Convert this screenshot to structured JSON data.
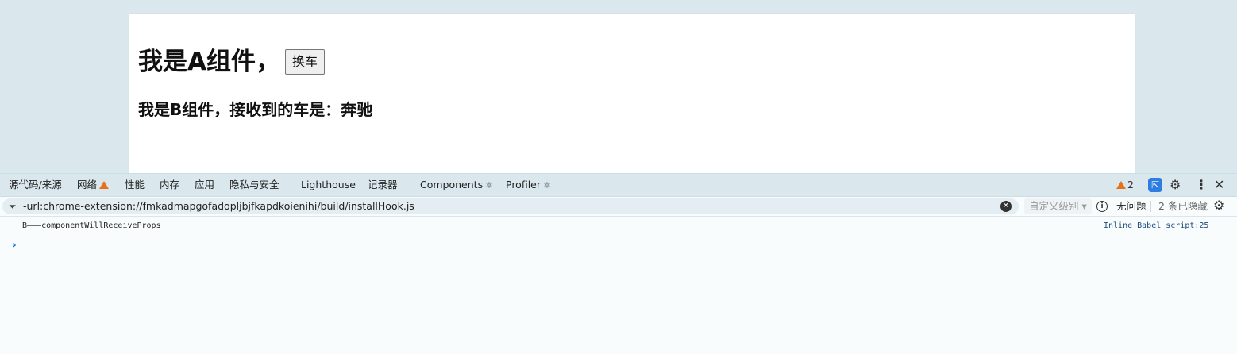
{
  "page": {
    "heading_a": "我是A组件，",
    "swap_button": "换车",
    "heading_b": "我是B组件，接收到的车是：奔驰"
  },
  "devtools": {
    "tabs": [
      "源代码/来源",
      "网络",
      "性能",
      "内存",
      "应用",
      "隐私与安全",
      "Lighthouse",
      "记录器",
      "Components",
      "Profiler"
    ],
    "warning_count": "2",
    "filter_text": "-url:chrome-extension://fmkadmapgofadopljbjfkapdkoienihi/build/installHook.js",
    "level_select": "自定义级别",
    "no_issues": "无问题",
    "hidden_count": "2 条已隐藏",
    "console_message": "B———componentWillReceiveProps",
    "console_source": "Inline Babel script:25",
    "icons": [
      "warning-icon",
      "react-icon",
      "dock-icon",
      "settings-icon",
      "more-icon",
      "close-icon",
      "filter-icon",
      "clear-icon",
      "info-icon",
      "console-settings-icon",
      "prompt-icon"
    ],
    "colors": {
      "warning": "#e8711a",
      "accent": "#2e7de0",
      "link": "#1a4b7a"
    }
  }
}
